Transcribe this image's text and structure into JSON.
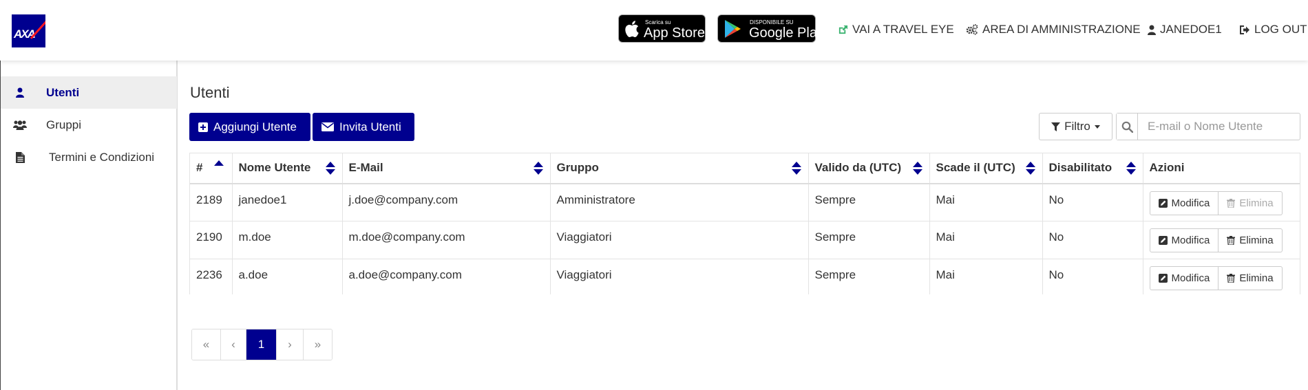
{
  "header": {
    "logo_text": "AXA",
    "appstore": {
      "small": "Scarica su",
      "big": "App Store"
    },
    "playstore": {
      "small": "DISPONIBILE SU",
      "big": "Google Play"
    },
    "links": {
      "travel_eye": "VAI A TRAVEL EYE",
      "admin": "AREA DI AMMINISTRAZIONE",
      "user": "JANEDOE1",
      "logout": "LOG OUT"
    }
  },
  "sidebar": {
    "items": [
      {
        "label": "Utenti",
        "icon": "user-icon",
        "active": true
      },
      {
        "label": "Gruppi",
        "icon": "users-icon",
        "active": false
      },
      {
        "label": "Termini e Condizioni",
        "icon": "document-icon",
        "active": false
      }
    ]
  },
  "main": {
    "title": "Utenti",
    "add_button": "Aggiungi Utente",
    "invite_button": "Invita Utenti",
    "filter_button": "Filtro",
    "search_placeholder": "E-mail o Nome Utente"
  },
  "table": {
    "columns": [
      "#",
      "Nome Utente",
      "E-Mail",
      "Gruppo",
      "Valido da (UTC)",
      "Scade il (UTC)",
      "Disabilitato",
      "Azioni"
    ],
    "rows": [
      {
        "id": "2189",
        "username": "janedoe1",
        "email": "j.doe@company.com",
        "group": "Amministratore",
        "valid_from": "Sempre",
        "expires": "Mai",
        "disabled": "No",
        "edit": "Modifica",
        "delete": "Elimina",
        "delete_enabled": false
      },
      {
        "id": "2190",
        "username": "m.doe",
        "email": "m.doe@company.com",
        "group": "Viaggiatori",
        "valid_from": "Sempre",
        "expires": "Mai",
        "disabled": "No",
        "edit": "Modifica",
        "delete": "Elimina",
        "delete_enabled": true
      },
      {
        "id": "2236",
        "username": "a.doe",
        "email": "a.doe@company.com",
        "group": "Viaggiatori",
        "valid_from": "Sempre",
        "expires": "Mai",
        "disabled": "No",
        "edit": "Modifica",
        "delete": "Elimina",
        "delete_enabled": true
      }
    ]
  },
  "pagination": {
    "first": "«",
    "prev": "‹",
    "current": "1",
    "next": "›",
    "last": "»"
  },
  "colors": {
    "brand": "#00008f",
    "logo_red": "#ff1721"
  }
}
